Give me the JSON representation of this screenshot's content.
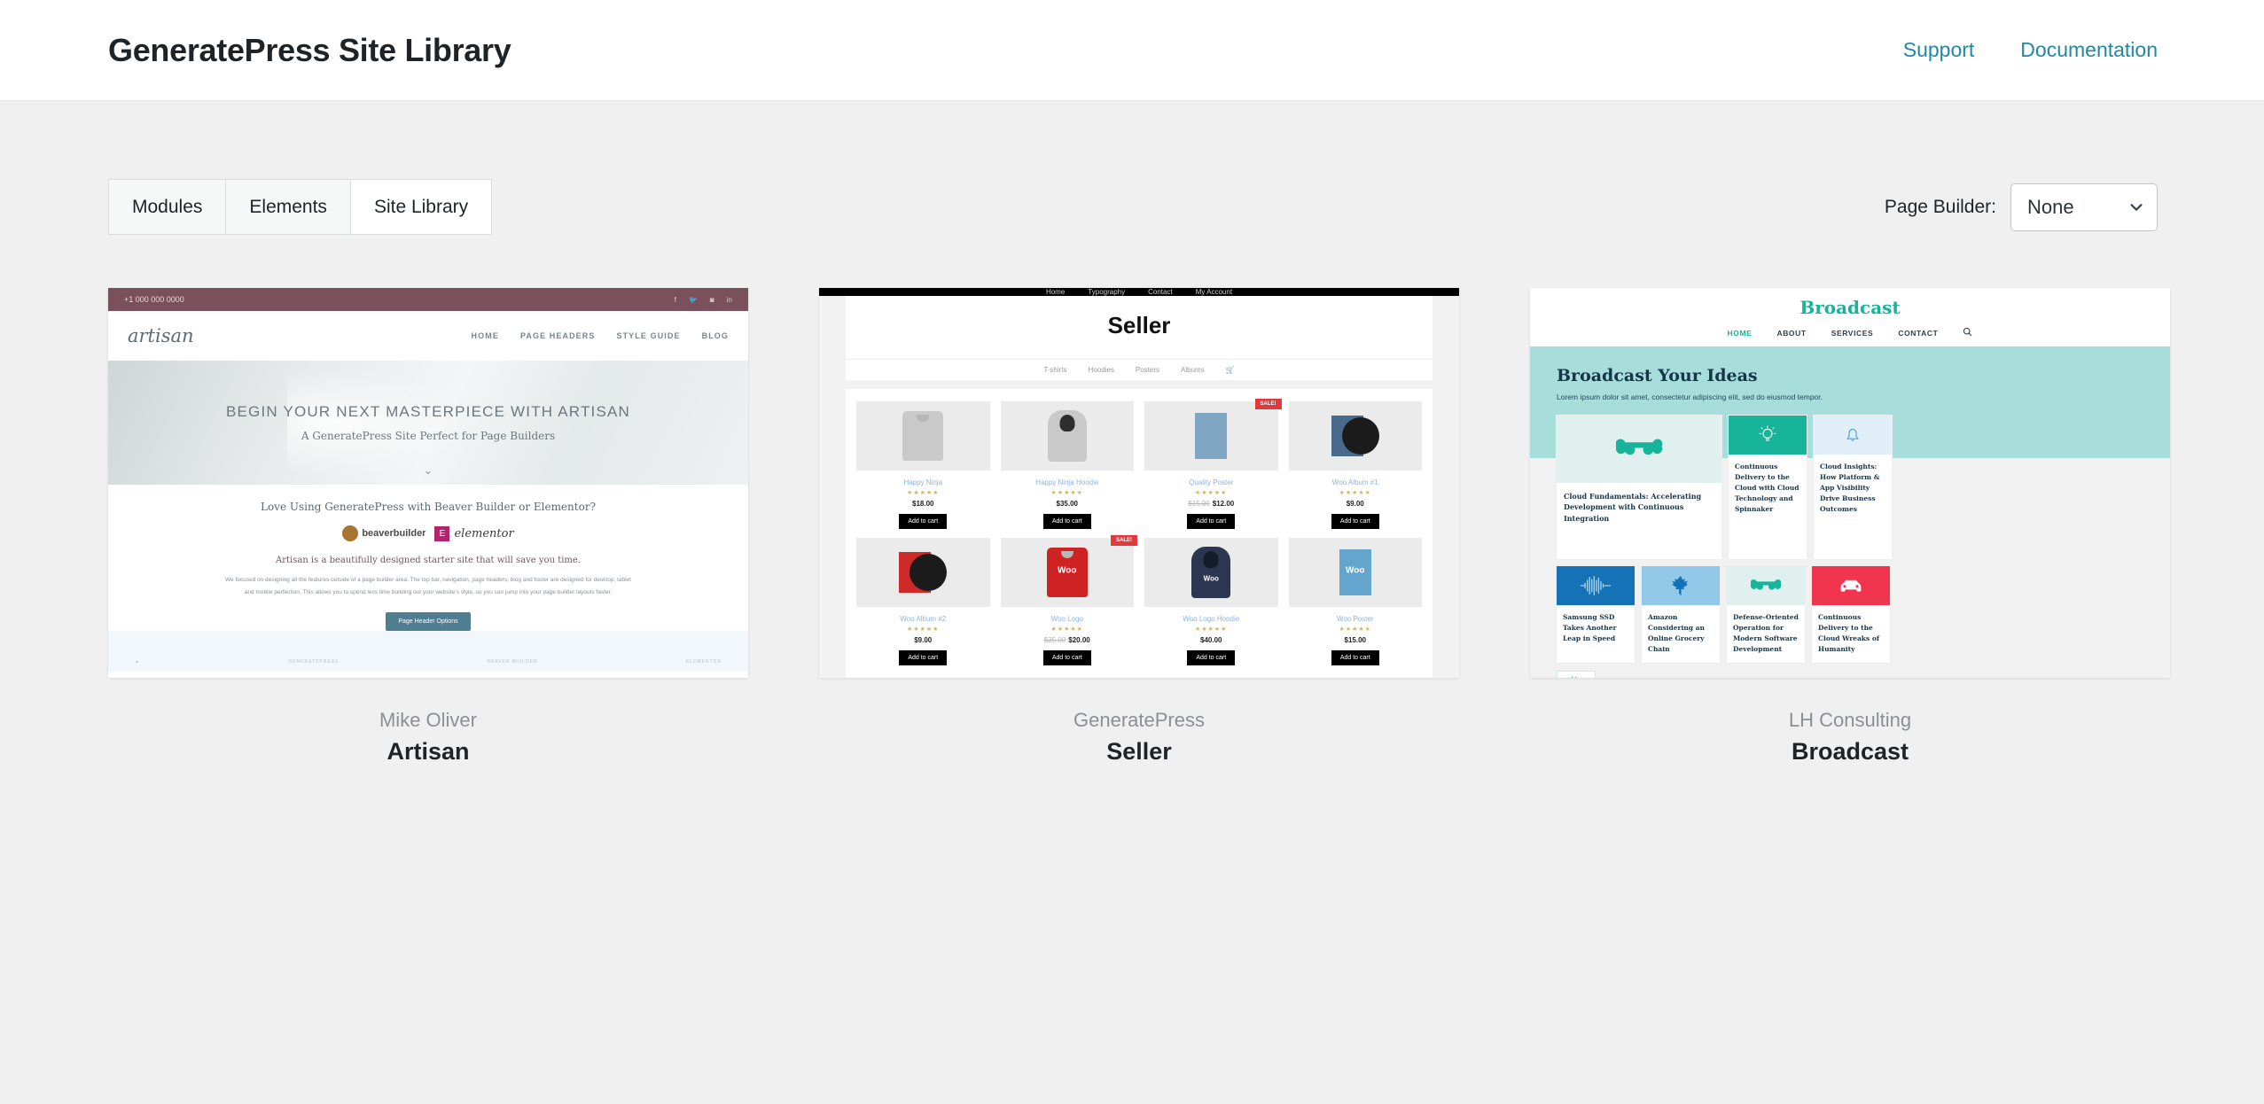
{
  "header": {
    "title": "GeneratePress Site Library",
    "nav": [
      {
        "label": "Support"
      },
      {
        "label": "Documentation"
      }
    ]
  },
  "toolbar": {
    "tabs": [
      {
        "label": "Modules",
        "active": false
      },
      {
        "label": "Elements",
        "active": false
      },
      {
        "label": "Site Library",
        "active": true
      }
    ],
    "page_builder_label": "Page Builder:",
    "page_builder_value": "None",
    "page_builder_options": [
      "None"
    ],
    "chevron_icon": "chevron-down-icon"
  },
  "cards": [
    {
      "author": "Mike Oliver",
      "name": "Artisan",
      "preview": {
        "phone": "+1 000 000 0000",
        "social": [
          "facebook-icon",
          "twitter-icon",
          "instagram-icon",
          "linkedin-icon"
        ],
        "logo": "artisan",
        "menu": [
          "HOME",
          "PAGE HEADERS",
          "STYLE GUIDE",
          "BLOG"
        ],
        "hero_title": "BEGIN YOUR NEXT MASTERPIECE WITH ARTISAN",
        "hero_sub": "A GeneratePress Site Perfect for Page Builders",
        "section_question": "Love Using GeneratePress with Beaver Builder or Elementor?",
        "logo_beaver": "beaverbuilder",
        "logo_elementor": "elementor",
        "subheading": "Artisan is a beautifully designed starter site that will save you time.",
        "paragraph": "We focused on designing all the features outside of a page builder area. The top bar, navigation, page headers, blog and footer are designed for desktop, tablet and mobile perfection. This allows you to spend less time building out your website's style, so you can jump into your page builder layouts faster.",
        "button": "Page Header Options",
        "footer_links": [
          "GENERATEPRESS",
          "BEAVER BUILDER",
          "ELEMENTOR"
        ]
      }
    },
    {
      "author": "GeneratePress",
      "name": "Seller",
      "preview": {
        "topnav": [
          "Home",
          "Typography",
          "Contact",
          "My Account"
        ],
        "title": "Seller",
        "subnav": [
          "T-shirts",
          "Hoodies",
          "Posters",
          "Albums"
        ],
        "cart_icon": "shopping-cart-icon",
        "add_to_cart_label": "Add to cart",
        "sale_badge": "SALE!",
        "products": [
          {
            "name": "Happy Ninja",
            "price": "$18.00",
            "old_price": "",
            "sale": false,
            "stars": "★★★★★",
            "kind": "shirt-grey"
          },
          {
            "name": "Happy Ninja Hoodie",
            "price": "$35.00",
            "old_price": "",
            "sale": false,
            "stars": "★★★★★",
            "kind": "hoodie-grey"
          },
          {
            "name": "Quality Poster",
            "price": "$12.00",
            "old_price": "$15.00",
            "sale": true,
            "stars": "★★★★★",
            "kind": "poster-blue"
          },
          {
            "name": "Woo Album #1",
            "price": "$9.00",
            "old_price": "",
            "sale": false,
            "stars": "★★★★★",
            "kind": "album-blue"
          },
          {
            "name": "Woo Album #2",
            "price": "$9.00",
            "old_price": "",
            "sale": false,
            "stars": "★★★★★",
            "kind": "album-red"
          },
          {
            "name": "Woo Logo",
            "price": "$20.00",
            "old_price": "$25.00",
            "sale": true,
            "stars": "★★★★★",
            "kind": "shirt-red"
          },
          {
            "name": "Woo Logo Hoodie",
            "price": "$40.00",
            "old_price": "",
            "sale": false,
            "stars": "★★★★★",
            "kind": "hoodie-navy"
          },
          {
            "name": "Woo Poster",
            "price": "$15.00",
            "old_price": "",
            "sale": false,
            "stars": "★★★★★",
            "kind": "poster-woo"
          }
        ]
      }
    },
    {
      "author": "LH Consulting",
      "name": "Broadcast",
      "preview": {
        "logo": "Broadcast",
        "menu": [
          "HOME",
          "ABOUT",
          "SERVICES",
          "CONTACT"
        ],
        "search_icon": "search-icon",
        "hero_title": "Broadcast Your Ideas",
        "hero_sub": "Lorem ipsum dolor sit amet, consectetur adipiscing elit, sed do eiusmod tempor.",
        "more_button": "+ More",
        "tiles_row1": [
          {
            "title": "Cloud Fundamentals: Accelerating Development with Continuous Integration",
            "icon": "bone-icon",
            "icon_color": "#17b39a",
            "tile_bg": "#dff0ee",
            "size": "large"
          },
          {
            "title": "Continuous Delivery to the Cloud with Cloud Technology and Spinnaker",
            "icon": "lightbulb-icon",
            "icon_color": "#ffffff",
            "tile_bg": "#17b39a",
            "size": "small"
          },
          {
            "title": "Cloud Insights: How Platform & App Visibility Drive Business Outcomes",
            "icon": "bell-icon",
            "icon_color": "#4aa3df",
            "tile_bg": "#dfeef7",
            "size": "small"
          }
        ],
        "tiles_row2": [
          {
            "title": "Samsung SSD Takes Another Leap in Speed",
            "icon": "waveform-icon",
            "icon_color": "#a9d4ee",
            "tile_bg": "#1572b6"
          },
          {
            "title": "Amazon Considering an Online Grocery Chain",
            "icon": "maple-leaf-icon",
            "icon_color": "#1572b6",
            "tile_bg": "#92c8e8"
          },
          {
            "title": "Defense-Oriented Operation for Modern Software Development",
            "icon": "bone-icon",
            "icon_color": "#17b39a",
            "tile_bg": "#dff0ee"
          },
          {
            "title": "Continuous Delivery to the Cloud Wreaks of Humanity",
            "icon": "car-icon",
            "icon_color": "#ffffff",
            "tile_bg": "#f2354f"
          }
        ]
      }
    }
  ],
  "colors": {
    "page_bg": "#f0f0f1",
    "link": "#2088a3",
    "text": "#1d2327",
    "muted": "#8c8f94"
  }
}
